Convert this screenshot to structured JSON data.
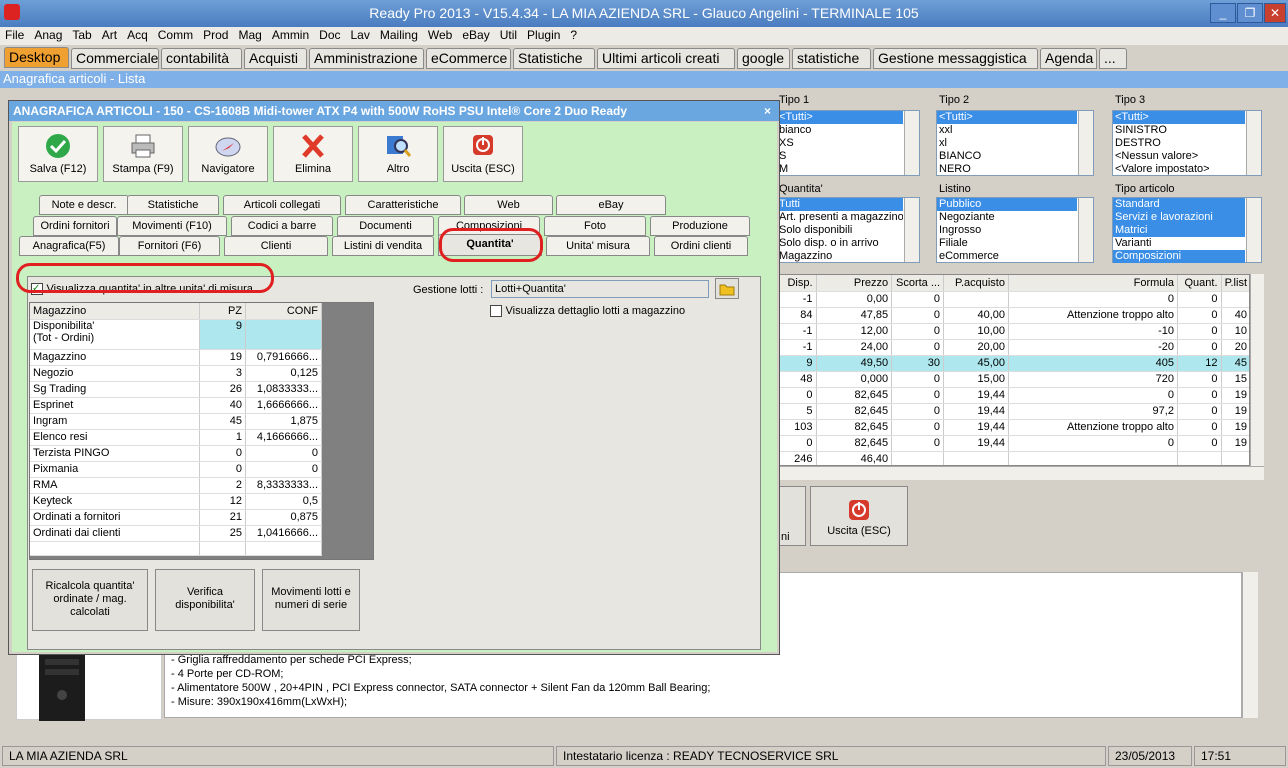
{
  "window": {
    "title": "Ready Pro 2013 - V15.4.34 - LA MIA AZIENDA SRL - Glauco Angelini - TERMINALE 105"
  },
  "menu": [
    "File",
    "Anag",
    "Tab",
    "Art",
    "Acq",
    "Comm",
    "Prod",
    "Mag",
    "Ammin",
    "Doc",
    "Lav",
    "Mailing",
    "Web",
    "eBay",
    "Util",
    "Plugin",
    "?"
  ],
  "main_tabs": [
    "Desktop",
    "Commerciale",
    "contabilità",
    "Acquisti",
    "Amministrazione",
    "eCommerce",
    "Statistiche",
    "Ultimi articoli creati",
    "google",
    "statistiche",
    "Gestione messaggistica",
    "Agenda",
    "..."
  ],
  "subtitle": "Anagrafica articoli  - Lista",
  "filters": {
    "tipo1": {
      "label": "Tipo 1",
      "items": [
        "<Tutti>",
        "bianco",
        "XS",
        "S",
        "M"
      ]
    },
    "tipo2": {
      "label": "Tipo 2",
      "items": [
        "<Tutti>",
        "xxl",
        "xl",
        "BIANCO",
        "NERO"
      ]
    },
    "tipo3": {
      "label": "Tipo 3",
      "items": [
        "<Tutti>",
        "SINISTRO",
        "DESTRO",
        "<Nessun valore>",
        "<Valore impostato>"
      ]
    },
    "quantita": {
      "label": "Quantita'",
      "items": [
        "Tutti",
        "Art. presenti a magazzino",
        "Solo disponibili",
        "Solo disp. o in arrivo",
        "Magazzino"
      ]
    },
    "listino": {
      "label": "Listino",
      "items": [
        "Pubblico",
        "Negoziante",
        "Ingrosso",
        "Filiale",
        "eCommerce"
      ]
    },
    "tipo_articolo": {
      "label": "Tipo articolo",
      "items": [
        "Standard",
        "Servizi e lavorazioni",
        "Matrici",
        "Varianti",
        "Composizioni"
      ]
    }
  },
  "list": {
    "headers": [
      "Disp.",
      "Prezzo",
      "Scorta ...",
      "P.acquisto",
      "Formula",
      "Quant.",
      "P.list"
    ],
    "rows": [
      [
        "-1",
        "0,00",
        "0",
        "",
        "0",
        "0",
        ""
      ],
      [
        "84",
        "47,85",
        "0",
        "40,00",
        "Attenzione troppo alto",
        "0",
        "40"
      ],
      [
        "-1",
        "12,00",
        "0",
        "10,00",
        "-10",
        "0",
        "10"
      ],
      [
        "-1",
        "24,00",
        "0",
        "20,00",
        "-20",
        "0",
        "20"
      ],
      [
        "9",
        "49,50",
        "30",
        "45,00",
        "405",
        "12",
        "45"
      ],
      [
        "48",
        "0,000",
        "0",
        "15,00",
        "720",
        "0",
        "15"
      ],
      [
        "0",
        "82,645",
        "0",
        "19,44",
        "0",
        "0",
        "19"
      ],
      [
        "5",
        "82,645",
        "0",
        "19,44",
        "97,2",
        "0",
        "19"
      ],
      [
        "103",
        "82,645",
        "0",
        "19,44",
        "Attenzione troppo alto",
        "0",
        "19"
      ],
      [
        "0",
        "82,645",
        "0",
        "19,44",
        "0",
        "0",
        "19"
      ],
      [
        "246",
        "46,40",
        "",
        "",
        "",
        "",
        ""
      ]
    ]
  },
  "bg_buttons": {
    "exit": "Uscita (ESC)",
    "partial": "ni"
  },
  "description_lines": [
    "- Griglia raffreddamento per schede PCI Express;",
    "- 4 Porte per CD-ROM;",
    "- Alimentatore 500W , 20+4PIN , PCI Express connector, SATA connector + Silent Fan da 120mm Ball Bearing;",
    "- Misure: 390x190x416mm(LxWxH);"
  ],
  "dialog": {
    "title": "ANAGRAFICA ARTICOLI - 150 - CS-1608B Midi-tower ATX P4 with 500W RoHS PSU Intel® Core 2 Duo Ready",
    "close": "×",
    "toolbar": [
      "Salva (F12)",
      "Stampa (F9)",
      "Navigatore",
      "Elimina",
      "Altro",
      "Uscita (ESC)"
    ],
    "tabs_row1": [
      "Note e descr.",
      "Statistiche",
      "Articoli collegati",
      "Caratteristiche",
      "Web",
      "eBay"
    ],
    "tabs_row2": [
      "Ordini fornitori",
      "Movimenti (F10)",
      "Codici a barre",
      "Documenti",
      "Composizioni",
      "Foto",
      "Produzione"
    ],
    "tabs_row3": [
      "Anagrafica(F5)",
      "Fornitori (F6)",
      "Clienti",
      "Listini di vendita",
      "Quantita'",
      "Unita' misura",
      "Ordini clienti"
    ],
    "checkbox_units": "Visualizza quantita' in altre unita' di misura",
    "gestione_lotti_label": "Gestione lotti :",
    "gestione_lotti_value": "Lotti+Quantita'",
    "checkbox_lotti": "Visualizza dettaglio lotti a magazzino",
    "qty_headers": [
      "Magazzino",
      "PZ",
      "CONF"
    ],
    "qty_rows": [
      [
        "Disponibilita'\n(Tot - Ordini)",
        "9",
        ""
      ],
      [
        "Magazzino",
        "19",
        "0,7916666..."
      ],
      [
        "Negozio",
        "3",
        "0,125"
      ],
      [
        "Sg Trading",
        "26",
        "1,0833333..."
      ],
      [
        "Esprinet",
        "40",
        "1,6666666..."
      ],
      [
        "Ingram",
        "45",
        "1,875"
      ],
      [
        "Elenco resi",
        "1",
        "4,1666666..."
      ],
      [
        "Terzista PINGO",
        "0",
        "0"
      ],
      [
        "Pixmania",
        "0",
        "0"
      ],
      [
        "RMA",
        "2",
        "8,3333333..."
      ],
      [
        "Keyteck",
        "12",
        "0,5"
      ],
      [
        "Ordinati a fornitori",
        "21",
        "0,875"
      ],
      [
        "Ordinati dai clienti",
        "25",
        "1,0416666..."
      ]
    ],
    "bottom_buttons": [
      "Ricalcola quantita' ordinate / mag. calcolati",
      "Verifica disponibilita'",
      "Movimenti lotti e numeri di serie"
    ]
  },
  "status": {
    "company": "LA MIA AZIENDA SRL",
    "license": "Intestatario licenza : READY TECNOSERVICE SRL",
    "date": "23/05/2013",
    "time": "17:51"
  }
}
